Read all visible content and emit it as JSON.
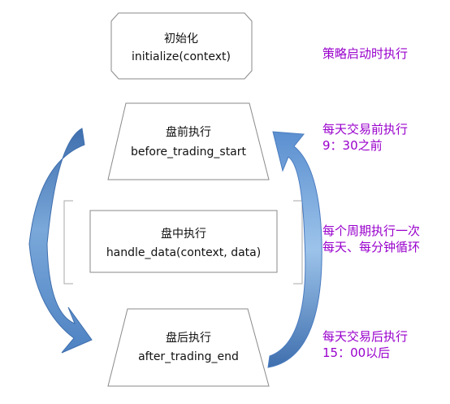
{
  "nodes": {
    "init": {
      "title": "初始化",
      "code": "initialize(context)"
    },
    "before": {
      "title": "盘前执行",
      "code": "before_trading_start"
    },
    "handle": {
      "title": "盘中执行",
      "code": "handle_data(context, data)"
    },
    "after": {
      "title": "盘后执行",
      "code": "after_trading_end"
    }
  },
  "notes": {
    "init": [
      "策略启动时执行"
    ],
    "before": [
      "每天交易前执行",
      "9：30之前"
    ],
    "handle": [
      "每个周期执行一次",
      "每天、每分钟循环"
    ],
    "after": [
      "每天交易后执行",
      "15：00以后"
    ]
  },
  "colors": {
    "note_text": "#9900cc",
    "arrow_light": "#9cc3ea",
    "arrow_dark": "#3f6fae",
    "node_border": "#8a8a8a"
  }
}
